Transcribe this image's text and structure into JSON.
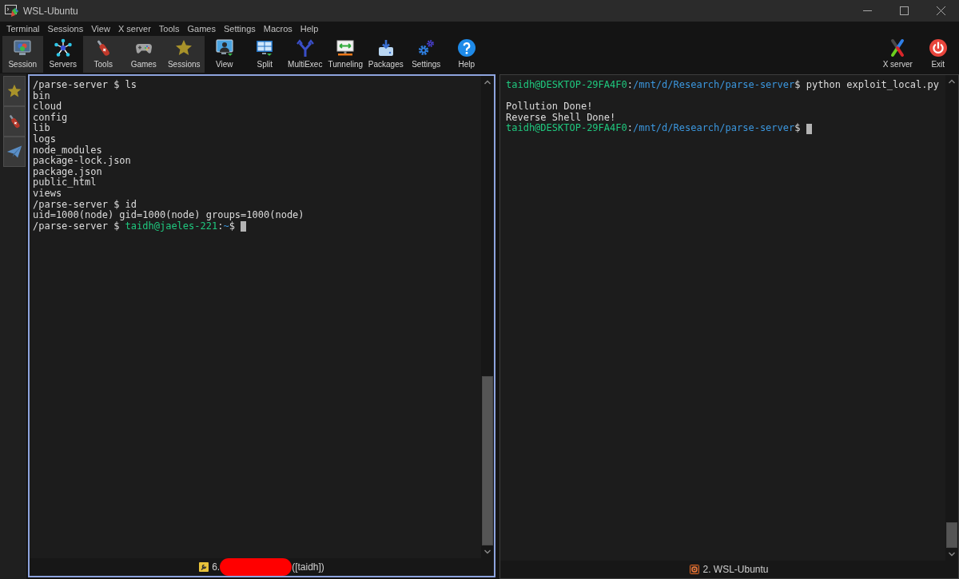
{
  "window": {
    "title": "WSL-Ubuntu"
  },
  "menu": [
    "Terminal",
    "Sessions",
    "View",
    "X server",
    "Tools",
    "Games",
    "Settings",
    "Macros",
    "Help"
  ],
  "toolbar": [
    {
      "label": "Session",
      "highlighted": true
    },
    {
      "label": "Servers",
      "highlighted": false
    },
    {
      "label": "Tools",
      "highlighted": true
    },
    {
      "label": "Games",
      "highlighted": true
    },
    {
      "label": "Sessions",
      "highlighted": true
    },
    {
      "label": "View",
      "highlighted": false
    },
    {
      "label": "Split",
      "highlighted": false
    },
    {
      "label": "MultiExec",
      "highlighted": false
    },
    {
      "label": "Tunneling",
      "highlighted": false
    },
    {
      "label": "Packages",
      "highlighted": false
    },
    {
      "label": "Settings",
      "highlighted": false
    },
    {
      "label": "Help",
      "highlighted": false
    }
  ],
  "toolbar_right": [
    {
      "label": "X server"
    },
    {
      "label": "Exit"
    }
  ],
  "panes": [
    {
      "active": true,
      "cursor": true,
      "lines": [
        {
          "blank": false,
          "segments": [
            {
              "kind": "text",
              "text": "/parse-server $ ls"
            }
          ]
        },
        {
          "blank": false,
          "segments": [
            {
              "kind": "text",
              "text": "bin"
            }
          ]
        },
        {
          "blank": false,
          "segments": [
            {
              "kind": "text",
              "text": "cloud"
            }
          ]
        },
        {
          "blank": false,
          "segments": [
            {
              "kind": "text",
              "text": "config"
            }
          ]
        },
        {
          "blank": false,
          "segments": [
            {
              "kind": "text",
              "text": "lib"
            }
          ]
        },
        {
          "blank": false,
          "segments": [
            {
              "kind": "text",
              "text": "logs"
            }
          ]
        },
        {
          "blank": false,
          "segments": [
            {
              "kind": "text",
              "text": "node_modules"
            }
          ]
        },
        {
          "blank": false,
          "segments": [
            {
              "kind": "text",
              "text": "package-lock.json"
            }
          ]
        },
        {
          "blank": false,
          "segments": [
            {
              "kind": "text",
              "text": "package.json"
            }
          ]
        },
        {
          "blank": false,
          "segments": [
            {
              "kind": "text",
              "text": "public_html"
            }
          ]
        },
        {
          "blank": false,
          "segments": [
            {
              "kind": "text",
              "text": "views"
            }
          ]
        },
        {
          "blank": false,
          "segments": [
            {
              "kind": "text",
              "text": "/parse-server $ id"
            }
          ]
        },
        {
          "blank": false,
          "segments": [
            {
              "kind": "text",
              "text": "uid=1000(node) gid=1000(node) groups=1000(node)"
            }
          ]
        },
        {
          "blank": false,
          "segments": [
            {
              "kind": "text",
              "text": "/parse-server $ "
            },
            {
              "kind": "user",
              "text": "taidh@jaeles-221"
            },
            {
              "kind": "text",
              "text": ":"
            },
            {
              "kind": "path",
              "text": "~"
            },
            {
              "kind": "text",
              "text": "$"
            }
          ]
        }
      ],
      "status": {
        "label": "6.",
        "redacted": true,
        "suffix": "([taidh])"
      }
    },
    {
      "active": false,
      "cursor": true,
      "lines": [
        {
          "blank": false,
          "segments": [
            {
              "kind": "user",
              "text": "taidh@DESKTOP-29FA4F0"
            },
            {
              "kind": "text",
              "text": ":"
            },
            {
              "kind": "path",
              "text": "/mnt/d/Research/parse-server"
            },
            {
              "kind": "text",
              "text": "$ python exploit_local.py"
            }
          ]
        },
        {
          "blank": true
        },
        {
          "blank": false,
          "segments": [
            {
              "kind": "text",
              "text": "Pollution Done!"
            }
          ]
        },
        {
          "blank": false,
          "segments": [
            {
              "kind": "text",
              "text": "Reverse Shell Done!"
            }
          ]
        },
        {
          "blank": false,
          "segments": [
            {
              "kind": "user",
              "text": "taidh@DESKTOP-29FA4F0"
            },
            {
              "kind": "text",
              "text": ":"
            },
            {
              "kind": "path",
              "text": "/mnt/d/Research/parse-server"
            },
            {
              "kind": "text",
              "text": "$"
            }
          ]
        }
      ],
      "status": {
        "label": "2. WSL-Ubuntu"
      }
    }
  ]
}
